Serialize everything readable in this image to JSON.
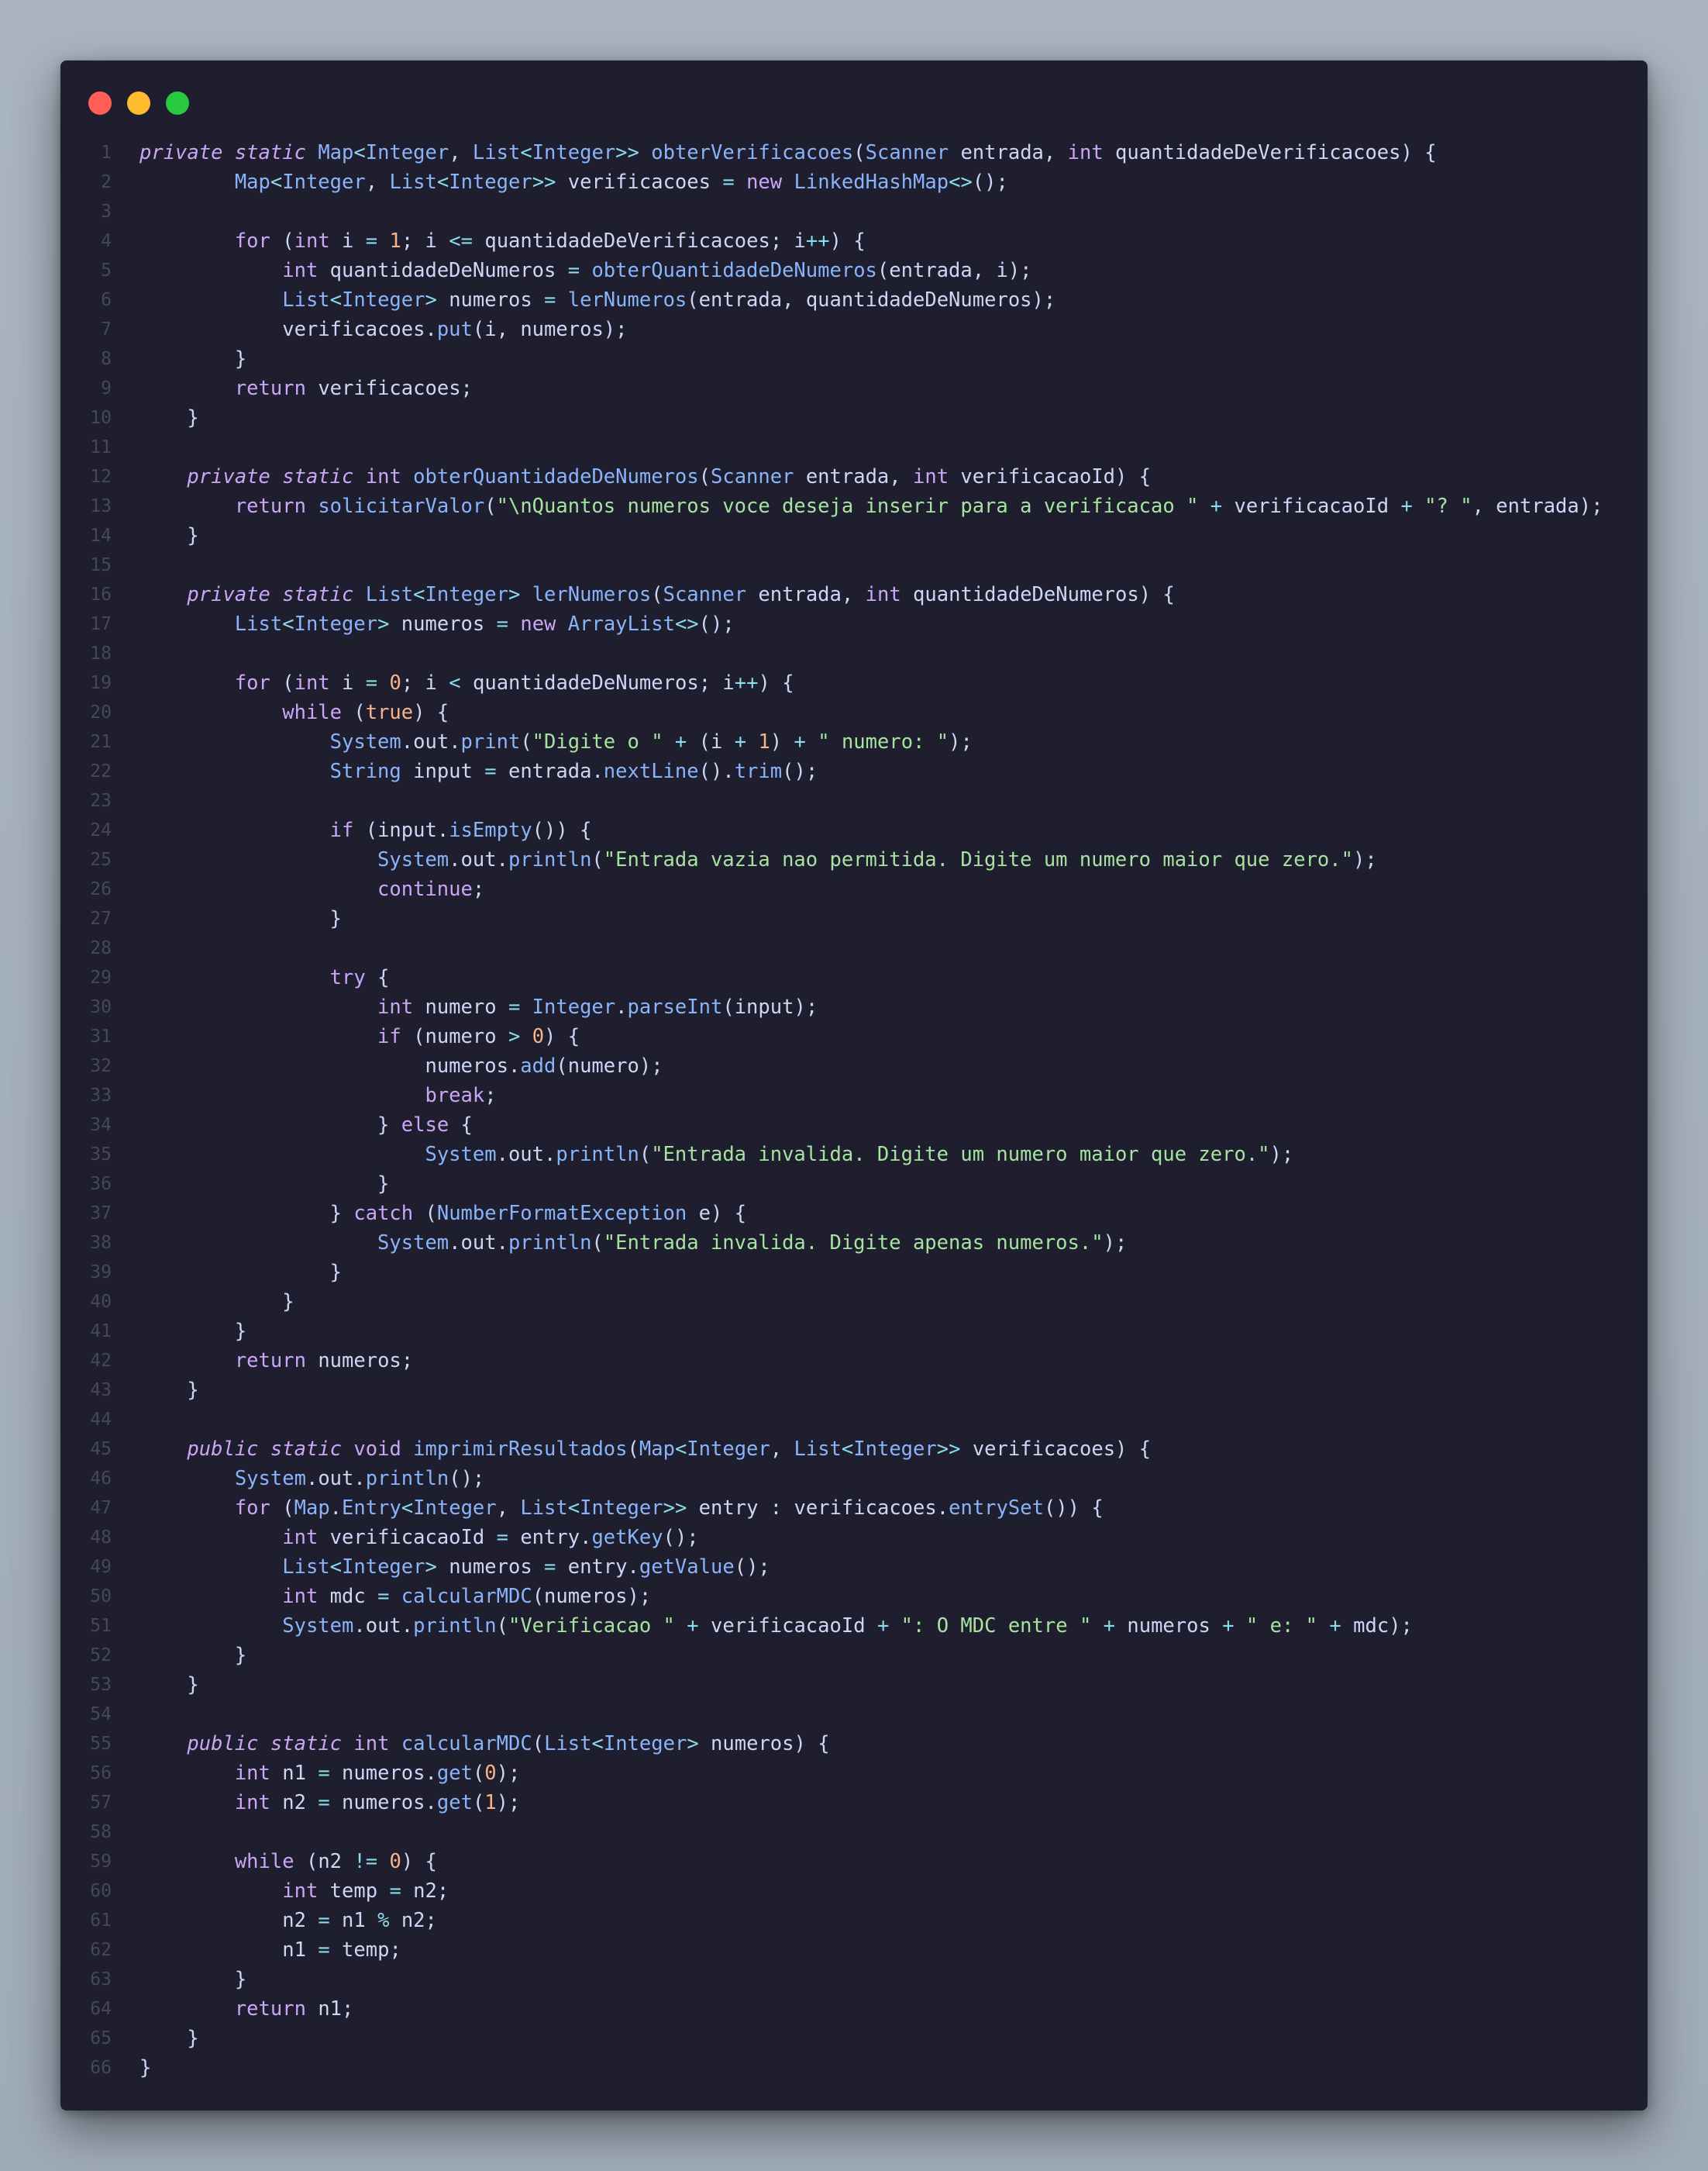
{
  "window": {
    "controls": [
      "close",
      "minimize",
      "maximize"
    ]
  },
  "code": {
    "language": "java",
    "lines": [
      "private static Map<Integer, List<Integer>> obterVerificacoes(Scanner entrada, int quantidadeDeVerificacoes) {",
      "        Map<Integer, List<Integer>> verificacoes = new LinkedHashMap<>();",
      "",
      "        for (int i = 1; i <= quantidadeDeVerificacoes; i++) {",
      "            int quantidadeDeNumeros = obterQuantidadeDeNumeros(entrada, i);",
      "            List<Integer> numeros = lerNumeros(entrada, quantidadeDeNumeros);",
      "            verificacoes.put(i, numeros);",
      "        }",
      "        return verificacoes;",
      "    }",
      "",
      "    private static int obterQuantidadeDeNumeros(Scanner entrada, int verificacaoId) {",
      "        return solicitarValor(\"\\nQuantos numeros voce deseja inserir para a verificacao \" + verificacaoId + \"? \", entrada);",
      "    }",
      "",
      "    private static List<Integer> lerNumeros(Scanner entrada, int quantidadeDeNumeros) {",
      "        List<Integer> numeros = new ArrayList<>();",
      "",
      "        for (int i = 0; i < quantidadeDeNumeros; i++) {",
      "            while (true) {",
      "                System.out.print(\"Digite o \" + (i + 1) + \" numero: \");",
      "                String input = entrada.nextLine().trim();",
      "",
      "                if (input.isEmpty()) {",
      "                    System.out.println(\"Entrada vazia nao permitida. Digite um numero maior que zero.\");",
      "                    continue;",
      "                }",
      "",
      "                try {",
      "                    int numero = Integer.parseInt(input);",
      "                    if (numero > 0) {",
      "                        numeros.add(numero);",
      "                        break;",
      "                    } else {",
      "                        System.out.println(\"Entrada invalida. Digite um numero maior que zero.\");",
      "                    }",
      "                } catch (NumberFormatException e) {",
      "                    System.out.println(\"Entrada invalida. Digite apenas numeros.\");",
      "                }",
      "            }",
      "        }",
      "        return numeros;",
      "    }",
      "",
      "    public static void imprimirResultados(Map<Integer, List<Integer>> verificacoes) {",
      "        System.out.println();",
      "        for (Map.Entry<Integer, List<Integer>> entry : verificacoes.entrySet()) {",
      "            int verificacaoId = entry.getKey();",
      "            List<Integer> numeros = entry.getValue();",
      "            int mdc = calcularMDC(numeros);",
      "            System.out.println(\"Verificacao \" + verificacaoId + \": O MDC entre \" + numeros + \" e: \" + mdc);",
      "        }",
      "    }",
      "",
      "    public static int calcularMDC(List<Integer> numeros) {",
      "        int n1 = numeros.get(0);",
      "        int n2 = numeros.get(1);",
      "",
      "        while (n2 != 0) {",
      "            int temp = n2;",
      "            n2 = n1 % n2;",
      "            n1 = temp;",
      "        }",
      "        return n1;",
      "    }",
      "}"
    ]
  }
}
